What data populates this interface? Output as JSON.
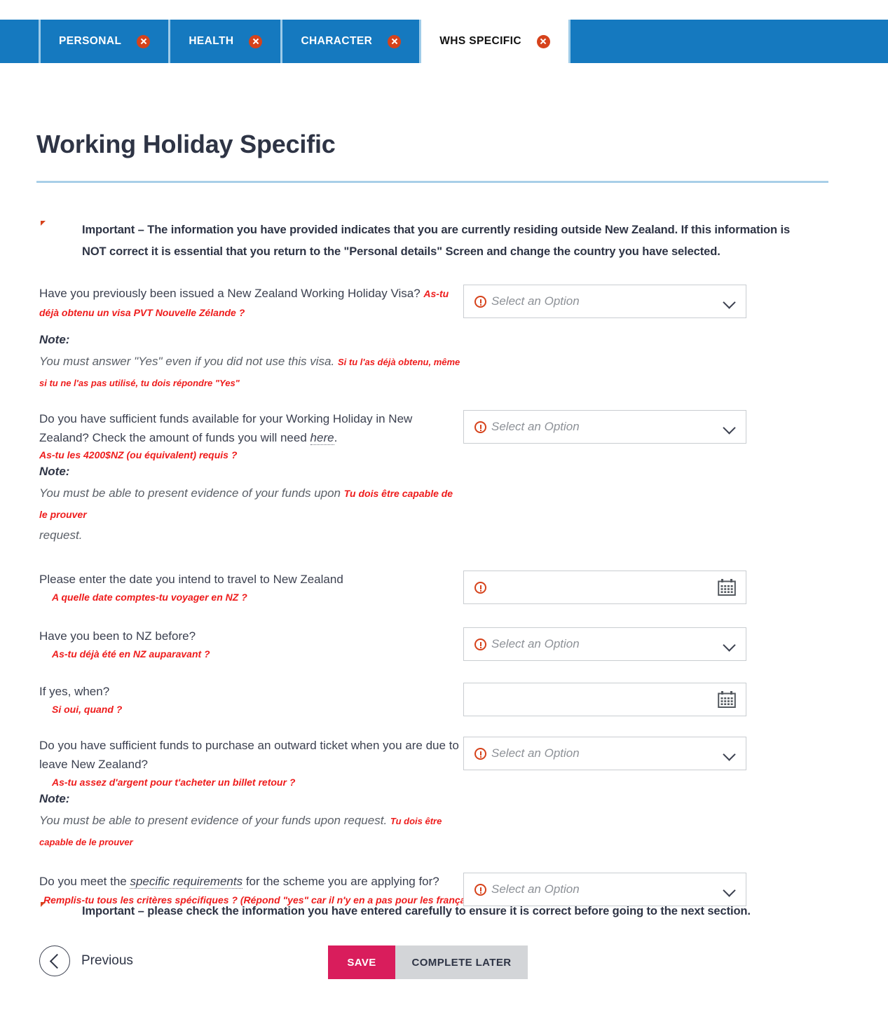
{
  "tabs": [
    {
      "label": "PERSONAL",
      "active": false,
      "close_icon": "close-circle-icon"
    },
    {
      "label": "HEALTH",
      "active": false,
      "close_icon": "close-circle-icon"
    },
    {
      "label": "CHARACTER",
      "active": false,
      "close_icon": "close-circle-icon"
    },
    {
      "label": "WHS SPECIFIC",
      "active": true,
      "close_icon": "close-circle-icon"
    }
  ],
  "page": {
    "title": "Working Holiday Specific"
  },
  "important_top": "Important – The information you have provided indicates that you are currently residing outside New Zealand. If this information is NOT correct it is essential that you return to the \"Personal details\" Screen and change the country you have selected.",
  "important_bottom": "Important – please check the information you have entered carefully to ensure it is correct before going to the next section.",
  "placeholder_select": "Select an Option",
  "note_label": "Note:",
  "questions": {
    "q1": {
      "text": "Have you previously been issued a New Zealand Working Holiday Visa?",
      "fr": "As-tu déjà obtenu un visa PVT Nouvelle Zélande ?",
      "note": "You must answer \"Yes\" even if you did not use this visa.",
      "note_fr": "Si tu l'as déjà obtenu, même si tu ne l'as pas utilisé, tu dois répondre \"Yes\""
    },
    "q2": {
      "text_a": "Do you have sufficient funds available for your Working Holiday in New Zealand? Check the amount of funds you will need ",
      "link": "here",
      "text_b": ".",
      "fr": "As-tu les 4200$NZ (ou équivalent) requis ?",
      "note_a": "You must be able to present evidence of your funds upon ",
      "note_fr": "Tu dois être capable de le prouver",
      "note_b": "request."
    },
    "q3": {
      "text": "Please enter the date you intend to travel to New Zealand",
      "fr": "A quelle date comptes-tu voyager en NZ ?"
    },
    "q4": {
      "text": "Have you been to NZ before?",
      "fr": "As-tu déjà été en NZ auparavant ?"
    },
    "q5": {
      "text": "If yes, when?",
      "fr": "Si oui, quand ?"
    },
    "q6": {
      "text": "Do you have sufficient funds to purchase an outward ticket when you are due to leave New Zealand?",
      "fr": "As-tu assez d'argent pour t'acheter un billet retour ?",
      "note_a": "You must be able to present evidence of your funds upon request. ",
      "note_fr": "Tu dois être capable de le prouver"
    },
    "q7": {
      "text_a": "Do you meet the ",
      "link": "specific requirements",
      "text_b": " for the scheme you are applying for?",
      "fr": "Remplis-tu tous les critères spécifiques ? (Répond \"yes\" car il n'y en a pas pour les français, belges et canadiens)"
    }
  },
  "footer": {
    "previous_label": "Previous",
    "save_label": "SAVE",
    "complete_later_label": "COMPLETE LATER"
  },
  "colors": {
    "tab_blue": "#1579bf",
    "accent_orange": "#d6421b",
    "annotation_red": "#ee1c1c",
    "save_pink": "#d91d5c",
    "heading_navy": "#2e3445",
    "rule_blue": "#a8cfe8"
  }
}
